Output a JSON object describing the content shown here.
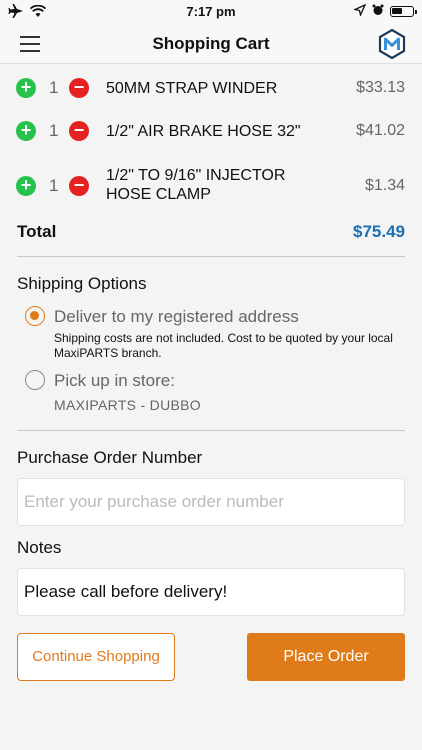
{
  "status_bar": {
    "time": "7:17 pm",
    "airplane_icon": "airplane-icon",
    "wifi_icon": "wifi-icon",
    "location_icon": "location-arrow-icon",
    "alarm_icon": "alarm-clock-icon",
    "battery_icon": "battery-icon"
  },
  "header": {
    "title": "Shopping Cart",
    "menu_icon": "hamburger-menu-icon",
    "logo_icon": "maxiparts-logo-icon"
  },
  "cart": {
    "items": [
      {
        "qty": "1",
        "name": "50MM STRAP WINDER",
        "price": "$33.13"
      },
      {
        "qty": "1",
        "name": "1/2\" AIR BRAKE HOSE 32\"",
        "price": "$41.02"
      },
      {
        "qty": "1",
        "name": "1/2\" TO 9/16\" INJECTOR HOSE CLAMP",
        "price": "$1.34"
      }
    ],
    "plus_symbol": "+",
    "minus_symbol": "−",
    "total_label": "Total",
    "total_value": "$75.49"
  },
  "shipping": {
    "title": "Shipping Options",
    "options": [
      {
        "label": "Deliver to my registered address",
        "note": "Shipping costs are not included. Cost to be quoted by your local MaxiPARTS branch.",
        "selected": true
      },
      {
        "label": "Pick up in store:",
        "sub": "MAXIPARTS - DUBBO",
        "selected": false
      }
    ]
  },
  "purchase_order": {
    "label": "Purchase Order Number",
    "value": "",
    "placeholder": "Enter your purchase order number"
  },
  "notes": {
    "label": "Notes",
    "value": "Please call before delivery!",
    "placeholder": ""
  },
  "actions": {
    "continue_label": "Continue Shopping",
    "place_order_label": "Place Order"
  },
  "colors": {
    "accent": "#e07b1a",
    "total": "#1b6fb3",
    "plus": "#27c24c",
    "minus": "#e52222"
  }
}
